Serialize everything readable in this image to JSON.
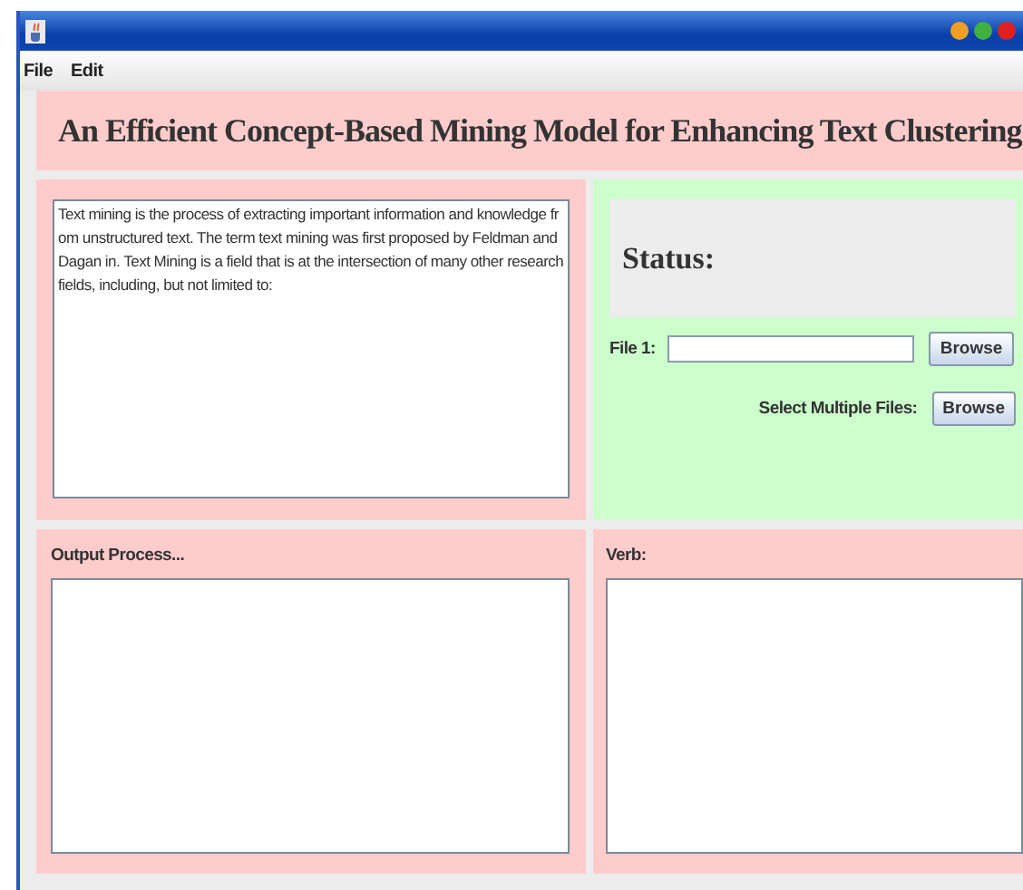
{
  "menu": [
    {
      "label": "File"
    },
    {
      "label": "Edit"
    }
  ],
  "header": {
    "title": "An Efficient Concept-Based Mining Model for Enhancing Text Clustering"
  },
  "input_panel": {
    "text": "Text mining is the process of extracting important information and knowledge from unstructured text. The term text mining was first proposed by Feldman and Dagan in. Text Mining is a field that is at the intersection of many other research fields, including, but not limited to:"
  },
  "status_panel": {
    "status_label": "Status:",
    "file_label": "File 1:",
    "file_button": "Browse",
    "multiple_label": "Select Multiple Files:",
    "multiple_button": "Browse"
  },
  "output_panel": {
    "label": "Output Process..."
  },
  "verb_panel": {
    "label": "Verb:"
  }
}
